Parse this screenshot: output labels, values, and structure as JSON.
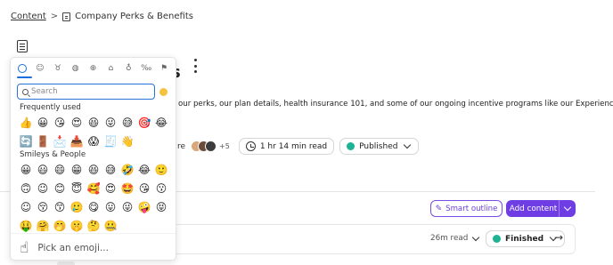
{
  "breadcrumb": {
    "root": "Content",
    "current": "Company Perks & Benefits"
  },
  "document": {
    "title_visible_tail": "s",
    "description_visible": "our perks, our plan details, health insurance 101, and some of our ongoing incentive programs like our Experience",
    "meta_cut_text": "re",
    "contributors_more": "+5",
    "read_time": "1 hr 14 min read",
    "status": "Published"
  },
  "actions": {
    "smart_outline": "Smart outline",
    "add_content": "Add content"
  },
  "content_card": {
    "read_time": "26m read",
    "status": "Finished"
  },
  "emoji_picker": {
    "search_placeholder": "Search",
    "preview_text": "Pick an emoji...",
    "preview_emoji": "☝",
    "sections": {
      "frequent": "Frequently used",
      "smileys": "Smileys & People"
    },
    "frequent_emojis": [
      "👍",
      "😀",
      "😘",
      "😍",
      "😆",
      "😜",
      "😅",
      "🎯",
      "😂",
      "🔄",
      "🚪",
      "📩",
      "📥",
      "😱",
      "🧾",
      "👋"
    ],
    "smiley_emojis": [
      "😀",
      "😃",
      "😄",
      "😁",
      "😆",
      "😅",
      "🤣",
      "😂",
      "🙂",
      "🙃",
      "😉",
      "😊",
      "😇",
      "🥰",
      "😍",
      "🤩",
      "😘",
      "😗",
      "☺",
      "😚",
      "😙",
      "🥲",
      "😋",
      "😛",
      "😜",
      "🤪",
      "😝",
      "🤑",
      "🤗",
      "🤭",
      "🤫",
      "🤔",
      "🤐"
    ]
  },
  "colors": {
    "accent": "#6e3ee4",
    "link_blue": "#1a6fe0",
    "status_green": "#1db394"
  }
}
